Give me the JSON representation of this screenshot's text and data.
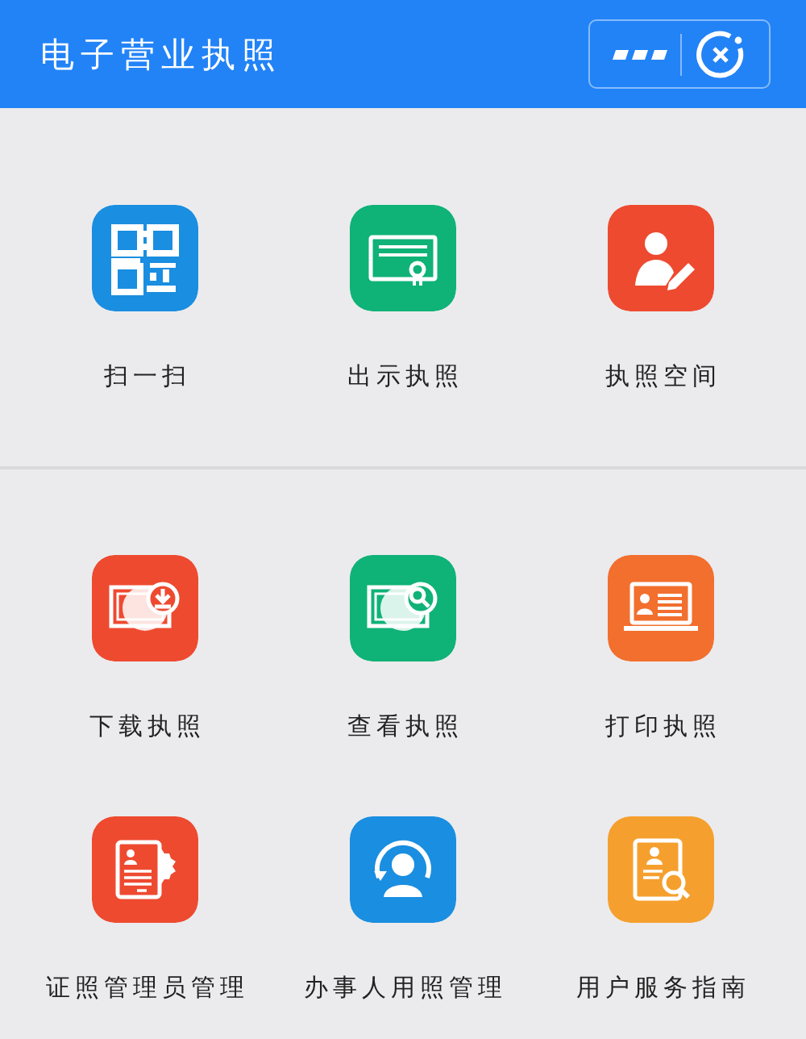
{
  "header": {
    "title": "电子营业执照"
  },
  "sections": [
    {
      "items": [
        {
          "label": "扫一扫",
          "kind": "qr",
          "color": "#1a8ee0"
        },
        {
          "label": "出示执照",
          "kind": "certificate",
          "color": "#0fb277"
        },
        {
          "label": "执照空间",
          "kind": "user-edit",
          "color": "#ee4a30"
        }
      ]
    },
    {
      "items": [
        {
          "label": "下载执照",
          "kind": "download",
          "color": "#ee4a30"
        },
        {
          "label": "查看执照",
          "kind": "view",
          "color": "#0fb277"
        },
        {
          "label": "打印执照",
          "kind": "print",
          "color": "#f26f2e"
        },
        {
          "label": "证照管理员管理",
          "kind": "manage",
          "color": "#ee4a30"
        },
        {
          "label": "办事人用照管理",
          "kind": "handler",
          "color": "#1a8ee0"
        },
        {
          "label": "用户服务指南",
          "kind": "guide",
          "color": "#f5a02e"
        }
      ]
    }
  ]
}
